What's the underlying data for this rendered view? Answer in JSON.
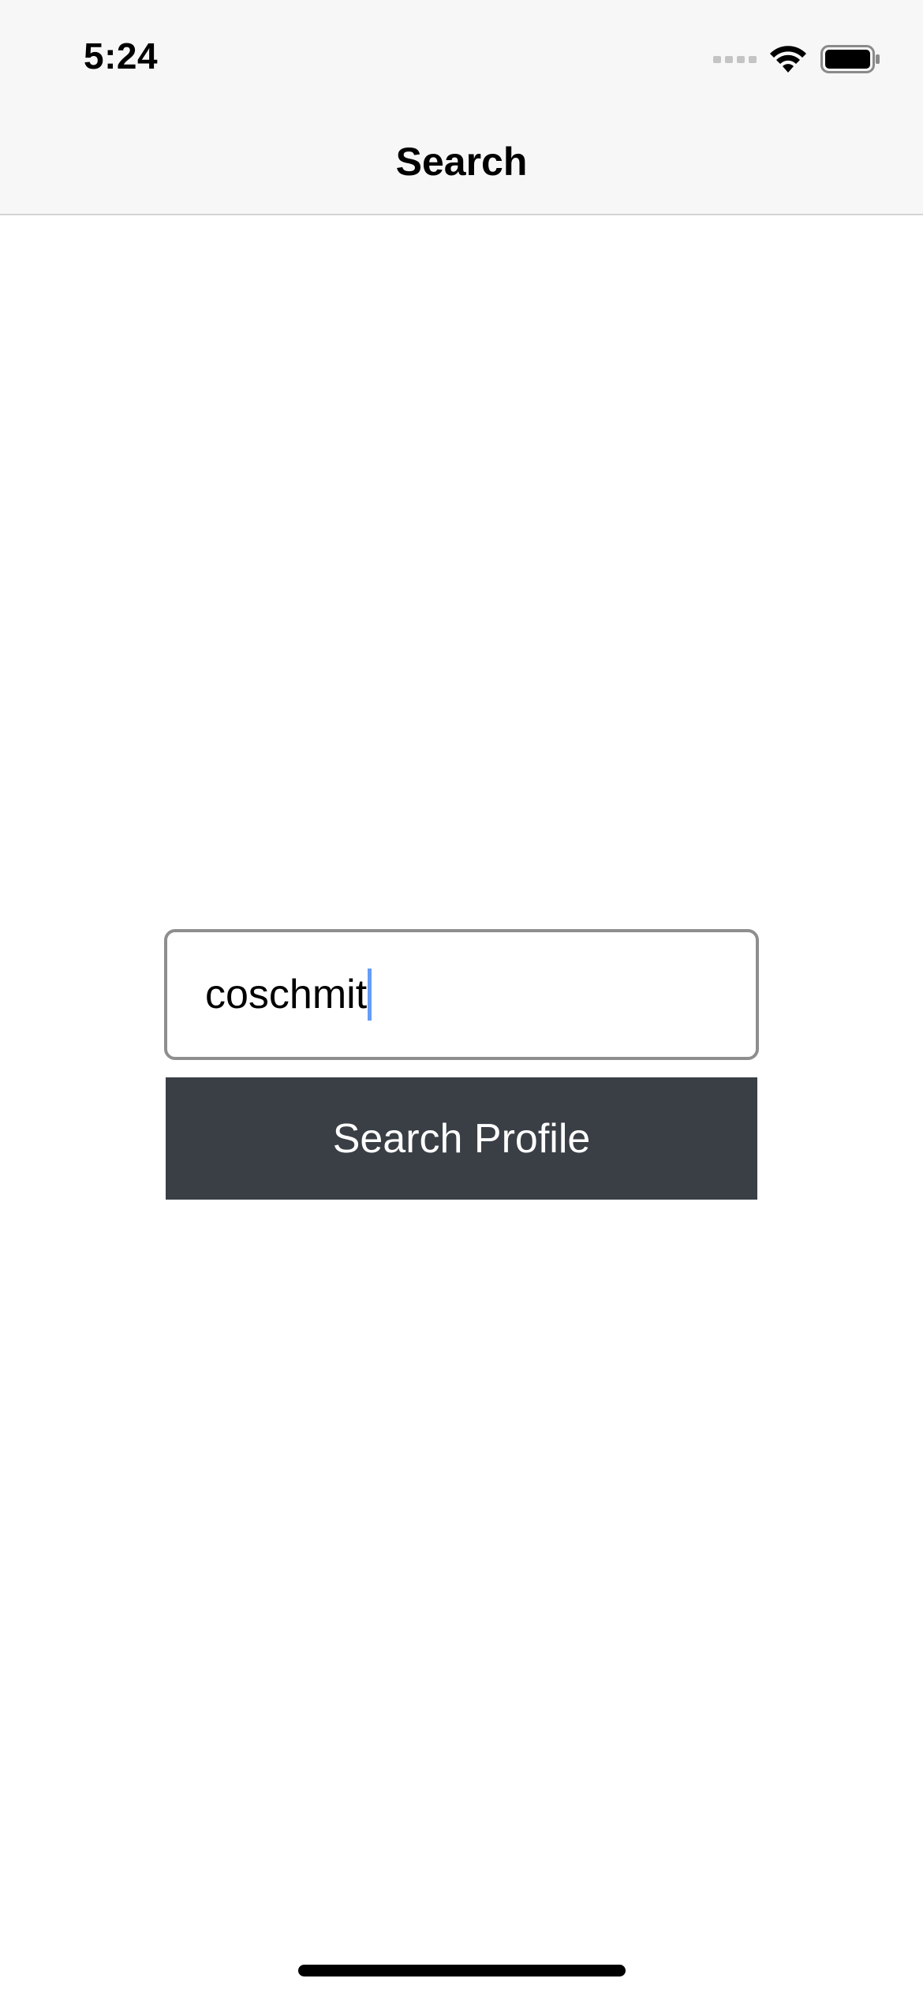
{
  "status_bar": {
    "time": "5:24",
    "icons": [
      "cellular-signal-icon",
      "wifi-icon",
      "battery-icon"
    ]
  },
  "nav": {
    "title": "Search"
  },
  "search": {
    "input_value": "coschmit",
    "button_label": "Search Profile"
  },
  "colors": {
    "nav_background": "#f7f7f7",
    "button_background": "#3a3f46",
    "button_text": "#ffffff",
    "input_border": "#8e8e8e",
    "caret": "#4a8cf7"
  }
}
